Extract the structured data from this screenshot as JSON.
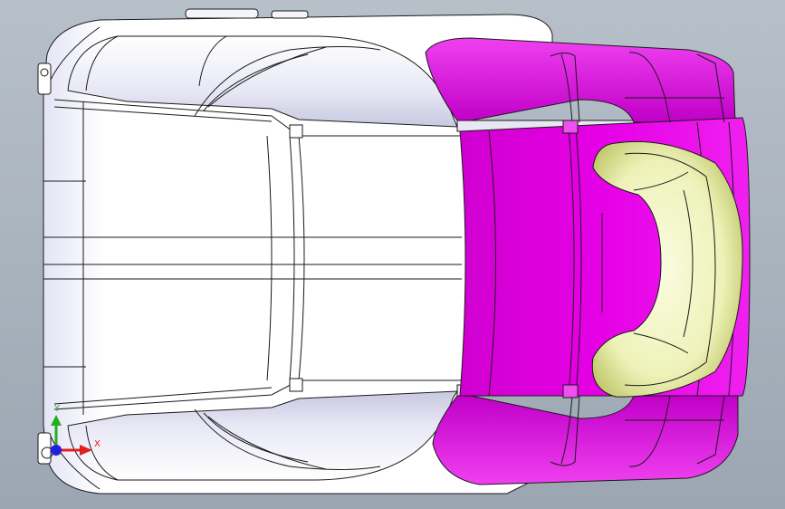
{
  "viewport": {
    "background_top": "#b7c0c9",
    "background_bottom": "#9ba6b2"
  },
  "model": {
    "body_fill": "#ffffff",
    "body_shade": "#d8d8ec",
    "edge_color": "#1a1a1a",
    "magenta_fill": "#e000e0",
    "magenta_shade": "#b000b8",
    "headrest_fill": "#f2f5c8",
    "headrest_shade": "#c9cf7a"
  },
  "triad": {
    "x_label": "X",
    "y_label": "Y",
    "x_color": "#e02020",
    "y_color": "#20b020",
    "z_color": "#2020e0"
  }
}
